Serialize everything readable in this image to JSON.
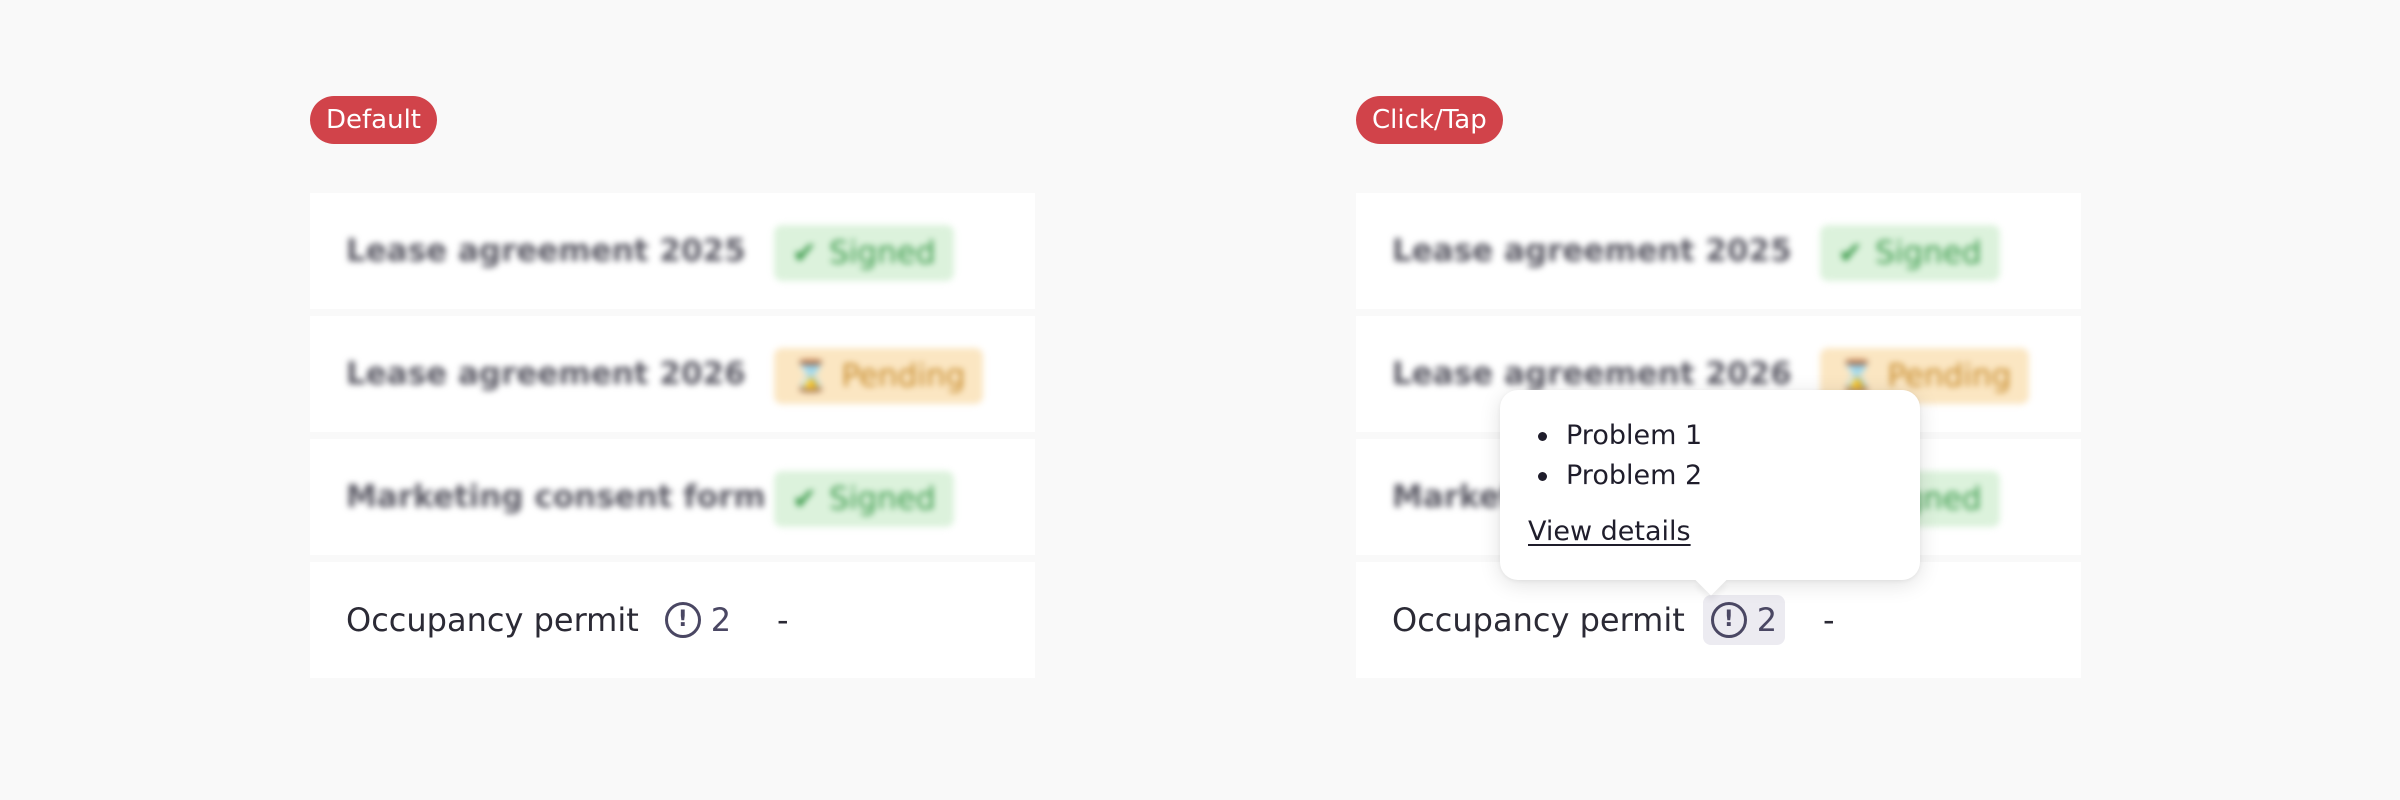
{
  "panels": [
    {
      "badge": "Default",
      "rows": [
        {
          "name": "Lease agreement 2025",
          "status": "Signed",
          "status_icon": "✔"
        },
        {
          "name": "Lease agreement 2026",
          "status": "Pending",
          "status_icon": "⌛"
        },
        {
          "name": "Marketing consent form",
          "status": "Signed",
          "status_icon": "✔"
        }
      ],
      "active_row": {
        "name": "Occupancy permit",
        "issue_icon": "!",
        "issue_count": "2",
        "status": "-"
      }
    },
    {
      "badge": "Click/Tap",
      "rows": [
        {
          "name": "Lease agreement 2025",
          "status": "Signed",
          "status_icon": "✔"
        },
        {
          "name": "Lease agreement 2026",
          "status": "Pending",
          "status_icon": "⌛"
        },
        {
          "name": "Marketing consent form",
          "status": "Signed",
          "status_icon": "✔"
        }
      ],
      "active_row": {
        "name": "Occupancy permit",
        "issue_icon": "!",
        "issue_count": "2",
        "status": "-"
      },
      "popover": {
        "problems": [
          "Problem 1",
          "Problem 2"
        ],
        "link_label": "View details"
      }
    }
  ],
  "colors": {
    "badge": "#d1434a",
    "signed_bg": "#dcf2dc",
    "signed_text": "#3a9a4a",
    "pending_bg": "#fbe6c2",
    "pending_text": "#c68a2a",
    "indicator_active_bg": "#ecebf1"
  },
  "icons": {
    "signed": "check-icon",
    "pending": "hourglass-icon",
    "issue": "alert-circle-icon"
  }
}
